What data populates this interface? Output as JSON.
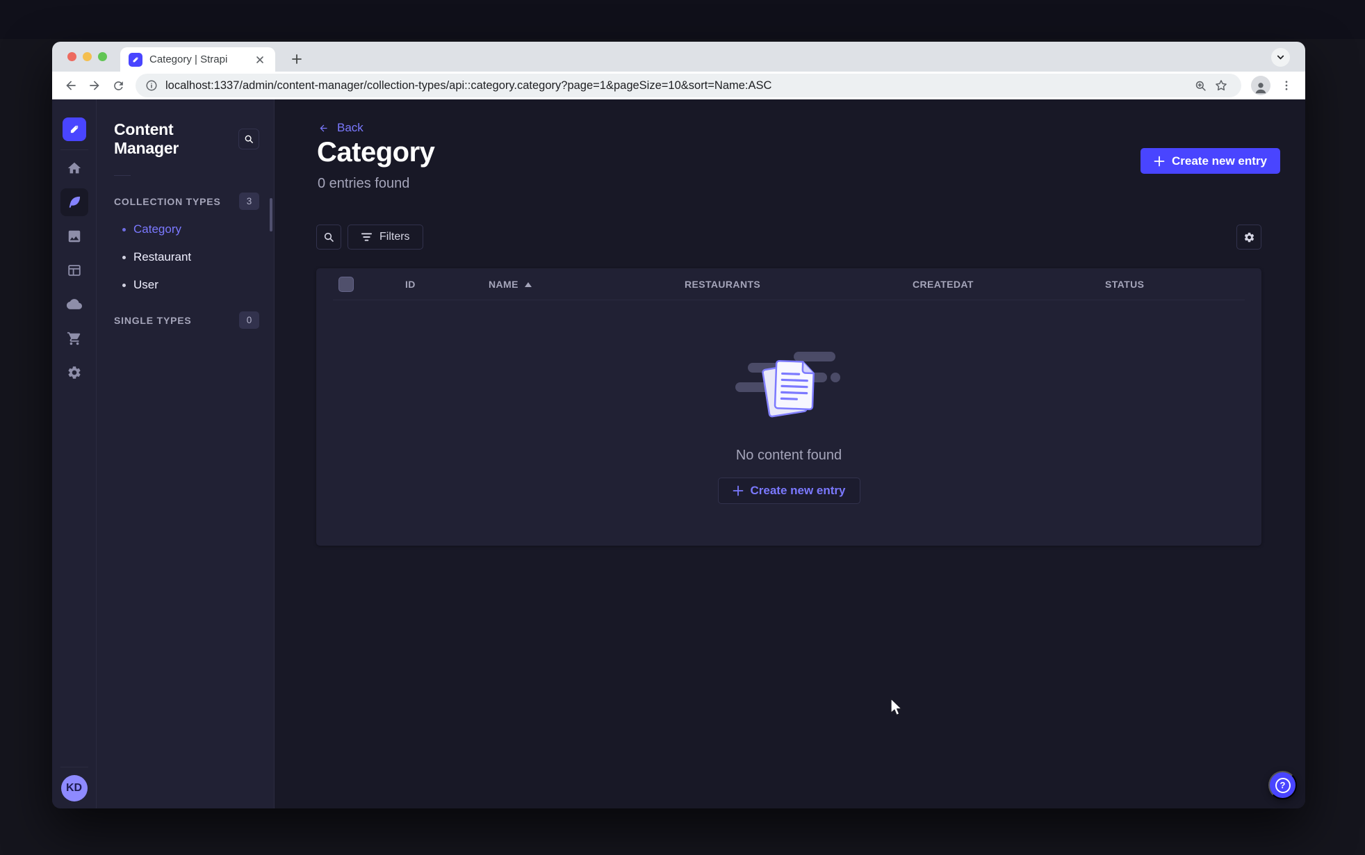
{
  "browser": {
    "tab_title": "Category | Strapi",
    "url": "localhost:1337/admin/content-manager/collection-types/api::category.category?page=1&pageSize=10&sort=Name:ASC"
  },
  "sidebar": {
    "icon_names": [
      "home-icon",
      "content-manager-icon",
      "media-library-icon",
      "content-type-builder-icon",
      "cloud-icon",
      "marketplace-icon",
      "settings-icon"
    ],
    "active_item": "content-manager",
    "avatar_initials": "KD"
  },
  "panel": {
    "title": "Content Manager",
    "collection_types_label": "COLLECTION TYPES",
    "collection_types_count": "3",
    "items": [
      {
        "label": "Category",
        "active": true
      },
      {
        "label": "Restaurant",
        "active": false
      },
      {
        "label": "User",
        "active": false
      }
    ],
    "single_types_label": "SINGLE TYPES",
    "single_types_count": "0"
  },
  "header": {
    "back_label": "Back",
    "title": "Category",
    "subtitle": "0 entries found",
    "create_button_label": "Create new entry"
  },
  "toolbar": {
    "filters_label": "Filters"
  },
  "table": {
    "headers": {
      "id": "ID",
      "name": "NAME",
      "restaurants": "RESTAURANTS",
      "createdat": "CREATEDAT",
      "status": "STATUS"
    },
    "sort": {
      "column": "NAME",
      "direction": "ASC"
    },
    "rows": []
  },
  "empty_state": {
    "message": "No content found",
    "create_button_label": "Create new entry"
  },
  "icons": {
    "help_glyph": "?"
  },
  "colors": {
    "primary": "#4945ff",
    "primary_light": "#7b79ff",
    "surface": "#212134",
    "background": "#181826",
    "border": "#32324d",
    "text_muted": "#a5a5ba",
    "browser_chrome": "#dee1e6"
  }
}
